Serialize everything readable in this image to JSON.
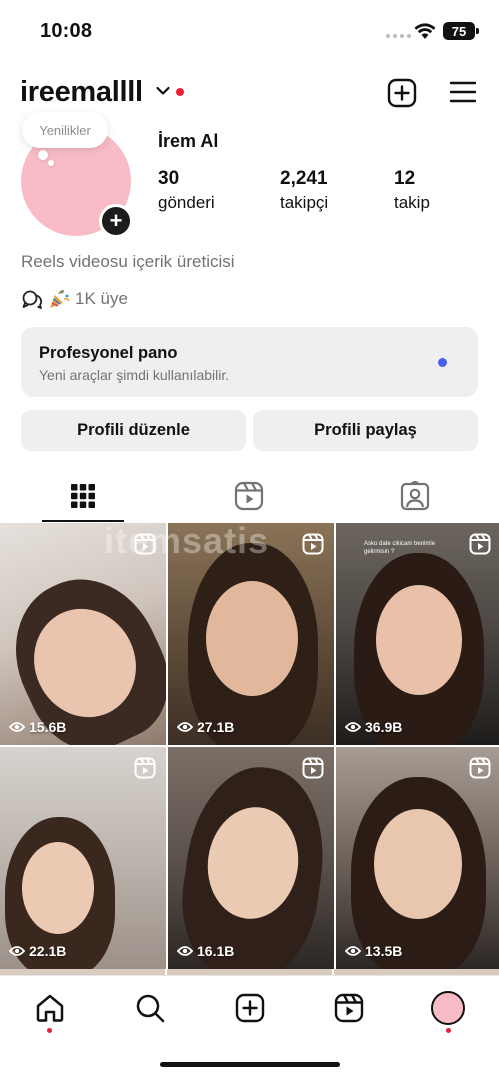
{
  "status_bar": {
    "time": "10:08",
    "battery": "75"
  },
  "header": {
    "username": "ireemallll"
  },
  "profile": {
    "notes_label": "Yenilikler",
    "full_name": "İrem Al",
    "stats": [
      {
        "value": "30",
        "label": "gönderi"
      },
      {
        "value": "2,241",
        "label": "takipçi"
      },
      {
        "value": "12",
        "label": "takip"
      }
    ],
    "bio": "Reels videosu içerik üreticisi",
    "community": "1K üye"
  },
  "pro_panel": {
    "title": "Profesyonel pano",
    "subtitle": "Yeni araçlar şimdi kullanılabilir."
  },
  "buttons": {
    "edit_profile": "Profili düzenle",
    "share_profile": "Profili paylaş"
  },
  "grid": [
    {
      "views": "15.6B",
      "caption": ""
    },
    {
      "views": "27.1B",
      "caption": ""
    },
    {
      "views": "36.9B",
      "caption": "Asko date cikicam benimle gelirmisin ?"
    },
    {
      "views": "22.1B",
      "caption": ""
    },
    {
      "views": "16.1B",
      "caption": ""
    },
    {
      "views": "13.5B",
      "caption": ""
    }
  ],
  "watermark": "itemsatis",
  "colors": {
    "accent_red": "#e8213a",
    "notification_blue": "#4a5ff0",
    "avatar_pink": "#f9bcc6",
    "panel_gray": "#efeff1"
  }
}
